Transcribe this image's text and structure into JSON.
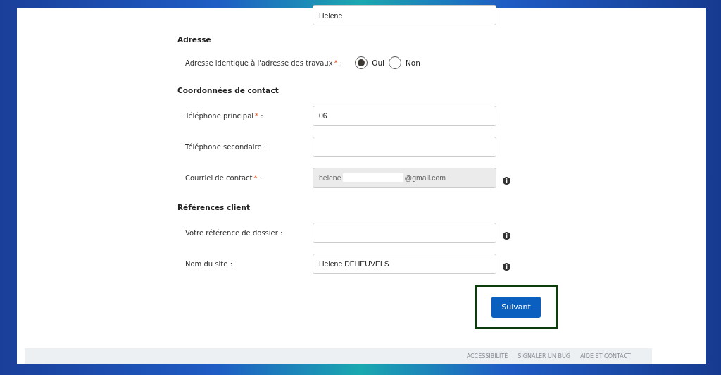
{
  "prefilled_field": {
    "value": "Helene"
  },
  "sections": [
    {
      "title": "Adresse",
      "fields": [
        {
          "kind": "radio",
          "label": "Adresse identique à l'adresse des travaux",
          "required_mark": "*",
          "suffix": ":",
          "options": [
            {
              "label": "Oui",
              "selected": true
            },
            {
              "label": "Non",
              "selected": false
            }
          ]
        }
      ]
    },
    {
      "title": "Coordonnées de contact",
      "fields": [
        {
          "kind": "text",
          "label": "Téléphone principal",
          "required_mark": "*",
          "suffix": ":",
          "value": "06",
          "disabled": false,
          "info": false
        },
        {
          "kind": "text",
          "label": "Téléphone secondaire",
          "suffix": ":",
          "disabled": false,
          "info": false
        },
        {
          "kind": "text",
          "label": "Courriel de contact",
          "required_mark": "*",
          "suffix": ":",
          "value": "helene",
          "redacted": true,
          "value_end": "@gmail.com",
          "disabled": true,
          "info": true
        }
      ]
    },
    {
      "title": "Références client",
      "fields": [
        {
          "kind": "text",
          "label": "Votre référence de dossier",
          "suffix": ":",
          "disabled": false,
          "info": true
        },
        {
          "kind": "text",
          "label": "Nom du site",
          "suffix": ":",
          "value": "Helene DEHEUVELS",
          "disabled": false,
          "info": true
        }
      ]
    }
  ],
  "submit_button": {
    "label": "Suivant",
    "highlighted": true
  },
  "footer": {
    "links": [
      "ACCESSIBILITÉ",
      "SIGNALER UN BUG",
      "AIDE ET CONTACT"
    ]
  }
}
